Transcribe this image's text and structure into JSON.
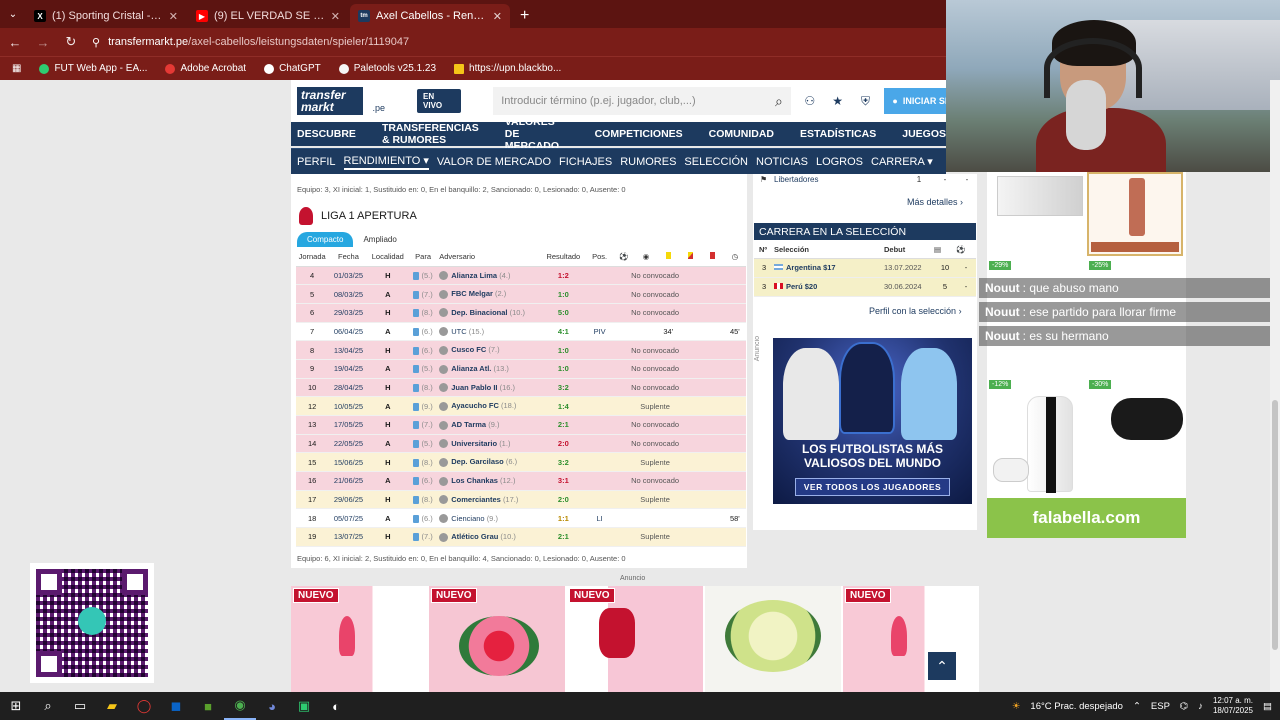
{
  "browser": {
    "tabs": [
      {
        "title": "(1) Sporting Cristal - Search / X",
        "fav": "X",
        "color": "#000000",
        "active": false
      },
      {
        "title": "(9) EL VERDAD SE FLOREÓ EN C",
        "fav": "▶",
        "color": "#ff0000",
        "active": false
      },
      {
        "title": "Axel Cabellos - Rendimiento 20",
        "fav": "tm",
        "color": "#1d3a5f",
        "active": true
      }
    ],
    "url_host": "transfermarkt.pe",
    "url_path": "/axel-cabellos/leistungsdaten/spieler/1119047",
    "bookmarks": [
      {
        "label": "FUT Web App - EA...",
        "color": "#2ecc71"
      },
      {
        "label": "Adobe Acrobat",
        "color": "#e53935"
      },
      {
        "label": "ChatGPT",
        "color": "#ffffff"
      },
      {
        "label": "Paletools v25.1.23",
        "color": "#f5f5f5"
      },
      {
        "label": "https://upn.blackbo...",
        "color": "#f5c518"
      }
    ]
  },
  "site": {
    "logo_top": "transfer",
    "logo_bottom": "markt",
    "country": ".pe",
    "live": "EN VIVO",
    "search_placeholder": "Introducir término (p.ej. jugador, club,...)",
    "login": "INICIAR SE",
    "nav": [
      "DESCUBRE",
      "TRANSFERENCIAS & RUMORES",
      "VALORES DE MERCADO",
      "COMPETICIONES",
      "COMUNIDAD",
      "ESTADÍSTICAS",
      "JUEGOS"
    ],
    "subnav": [
      "PERFIL",
      "RENDIMIENTO ▾",
      "VALOR DE MERCADO",
      "FICHAJES",
      "RUMORES",
      "SELECCIÓN",
      "NOTICIAS",
      "LOGROS",
      "CARRERA ▾"
    ]
  },
  "performance": {
    "summary_top": "Equipo: 3, XI inicial: 1, Sustituido en: 0, En el banquillo: 2, Sancionado: 0, Lesionado: 0, Ausente: 0",
    "league": "LIGA 1 APERTURA",
    "view_tabs": [
      "Compacto",
      "Ampliado"
    ],
    "columns": [
      "Jornada",
      "Fecha",
      "Localidad",
      "Para",
      "Adversario",
      "Resultado",
      "Pos."
    ],
    "rows": [
      {
        "j": "4",
        "d": "01/03/25",
        "l": "H",
        "p": "(5.)",
        "o": "Alianza Lima",
        "r": "(4.)",
        "res": "1:2",
        "rt": "l",
        "pos": "",
        "min": "",
        "st": "No convocado",
        "t": "nc"
      },
      {
        "j": "5",
        "d": "08/03/25",
        "l": "A",
        "p": "(7.)",
        "o": "FBC Melgar",
        "r": "(2.)",
        "res": "1:0",
        "rt": "w",
        "pos": "",
        "min": "",
        "st": "No convocado",
        "t": "nc"
      },
      {
        "j": "6",
        "d": "29/03/25",
        "l": "H",
        "p": "(8.)",
        "o": "Dep. Binacional",
        "r": "(10.)",
        "res": "5:0",
        "rt": "w",
        "pos": "",
        "min": "",
        "st": "No convocado",
        "t": "nc"
      },
      {
        "j": "7",
        "d": "06/04/25",
        "l": "A",
        "p": "(6.)",
        "o": "UTC",
        "r": "(15.)",
        "res": "4:1",
        "rt": "w",
        "pos": "PIV",
        "min": "34'",
        "st": "45'",
        "t": "pl"
      },
      {
        "j": "8",
        "d": "13/04/25",
        "l": "H",
        "p": "(6.)",
        "o": "Cusco FC",
        "r": "(7.)",
        "res": "1:0",
        "rt": "w",
        "pos": "",
        "min": "",
        "st": "No convocado",
        "t": "nc"
      },
      {
        "j": "9",
        "d": "19/04/25",
        "l": "A",
        "p": "(5.)",
        "o": "Alianza Atl.",
        "r": "(13.)",
        "res": "1:0",
        "rt": "w",
        "pos": "",
        "min": "",
        "st": "No convocado",
        "t": "nc"
      },
      {
        "j": "10",
        "d": "28/04/25",
        "l": "H",
        "p": "(8.)",
        "o": "Juan Pablo II",
        "r": "(16.)",
        "res": "3:2",
        "rt": "w",
        "pos": "",
        "min": "",
        "st": "No convocado",
        "t": "nc"
      },
      {
        "j": "12",
        "d": "10/05/25",
        "l": "A",
        "p": "(9.)",
        "o": "Ayacucho FC",
        "r": "(18.)",
        "res": "1:4",
        "rt": "w",
        "pos": "",
        "min": "",
        "st": "Suplente",
        "t": "sup"
      },
      {
        "j": "13",
        "d": "17/05/25",
        "l": "H",
        "p": "(7.)",
        "o": "AD Tarma",
        "r": "(9.)",
        "res": "2:1",
        "rt": "w",
        "pos": "",
        "min": "",
        "st": "No convocado",
        "t": "nc"
      },
      {
        "j": "14",
        "d": "22/05/25",
        "l": "A",
        "p": "(5.)",
        "o": "Universitario",
        "r": "(1.)",
        "res": "2:0",
        "rt": "l",
        "pos": "",
        "min": "",
        "st": "No convocado",
        "t": "nc"
      },
      {
        "j": "15",
        "d": "15/06/25",
        "l": "H",
        "p": "(8.)",
        "o": "Dep. Garcilaso",
        "r": "(6.)",
        "res": "3:2",
        "rt": "w",
        "pos": "",
        "min": "",
        "st": "Suplente",
        "t": "sup"
      },
      {
        "j": "16",
        "d": "21/06/25",
        "l": "A",
        "p": "(6.)",
        "o": "Los Chankas",
        "r": "(12.)",
        "res": "3:1",
        "rt": "l",
        "pos": "",
        "min": "",
        "st": "No convocado",
        "t": "nc"
      },
      {
        "j": "17",
        "d": "29/06/25",
        "l": "H",
        "p": "(8.)",
        "o": "Comerciantes",
        "r": "(17.)",
        "res": "2:0",
        "rt": "w",
        "pos": "",
        "min": "",
        "st": "Suplente",
        "t": "sup"
      },
      {
        "j": "18",
        "d": "05/07/25",
        "l": "A",
        "p": "(6.)",
        "o": "Cienciano",
        "r": "(9.)",
        "res": "1:1",
        "rt": "d",
        "pos": "LI",
        "min": "",
        "st": "58'",
        "t": "pl"
      },
      {
        "j": "19",
        "d": "13/07/25",
        "l": "H",
        "p": "(7.)",
        "o": "Atlético Grau",
        "r": "(10.)",
        "res": "2:1",
        "rt": "w",
        "pos": "",
        "min": "",
        "st": "Suplente",
        "t": "sup"
      }
    ],
    "summary_bottom": "Equipo: 6, XI inicial: 2, Sustituido en: 0, En el banquillo: 4, Sancionado: 0, Lesionado: 0, Ausente: 0"
  },
  "right": {
    "lib_label": "Libertadores",
    "lib_vals": [
      "1",
      "-",
      "-"
    ],
    "more": "Más detalles",
    "sel_title": "CARRERA EN LA SELECCIÓN",
    "sel_cols": [
      "Nº",
      "Selección",
      "Debut"
    ],
    "sel_rows": [
      {
        "n": "3",
        "team": "Argentina $17",
        "debut": "13.07.2022",
        "a": "10",
        "b": "-"
      },
      {
        "n": "3",
        "team": "Perú $20",
        "debut": "30.06.2024",
        "a": "5",
        "b": "-"
      }
    ],
    "profile_link": "Perfil con la selección",
    "anuncio": "Anuncio",
    "ad_title_1": "LOS FUTBOLISTAS MÁS",
    "ad_title_2": "VALIOSOS DEL MUNDO",
    "ad_cta": "VER TODOS LOS JUGADORES"
  },
  "side_ad": {
    "badges": [
      "-29%",
      "-25%",
      "-12%",
      "-30%"
    ],
    "brand": "falabella.com"
  },
  "chat": [
    {
      "user": "Nouut",
      "msg": ": que abuso mano"
    },
    {
      "user": "Nouut",
      "msg": ": ese partido para llorar firme"
    },
    {
      "user": "Nouut",
      "msg": ": es su hermano"
    }
  ],
  "bottom_ad": {
    "anuncio": "Anuncio",
    "nuevo": "NUEVO"
  },
  "taskbar": {
    "weather": "16°C  Prac. despejado",
    "lang": "ESP",
    "time": "12:07 a. m.",
    "date": "18/07/2025"
  }
}
